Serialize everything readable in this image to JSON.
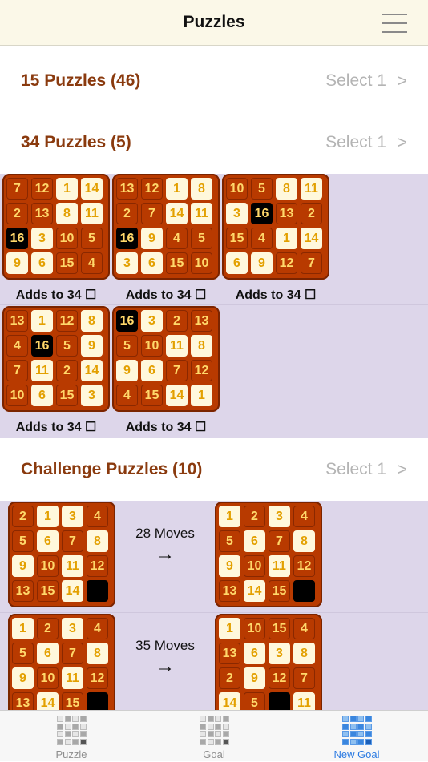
{
  "nav": {
    "title": "Puzzles",
    "menu_icon": "hamburger-menu-icon"
  },
  "sections": {
    "p15": {
      "title": "15 Puzzles (46)",
      "select": "Select 1",
      "chevron": ">"
    },
    "p34": {
      "title": "34 Puzzles (5)",
      "select": "Select 1",
      "chevron": ">"
    },
    "challenge": {
      "title": "Challenge Puzzles (10)",
      "select": "Select 1",
      "chevron": ">"
    }
  },
  "magic": [
    {
      "caption": "Adds to 34 ☐",
      "grid": [
        [
          7,
          12,
          1,
          14
        ],
        [
          2,
          13,
          8,
          11
        ],
        [
          16,
          3,
          10,
          5
        ],
        [
          9,
          6,
          15,
          4
        ]
      ]
    },
    {
      "caption": "Adds to 34 ☐",
      "grid": [
        [
          13,
          12,
          1,
          8
        ],
        [
          2,
          7,
          14,
          11
        ],
        [
          16,
          9,
          4,
          5
        ],
        [
          3,
          6,
          15,
          10
        ]
      ]
    },
    {
      "caption": "Adds to 34 ☐",
      "grid": [
        [
          10,
          5,
          8,
          11
        ],
        [
          3,
          16,
          13,
          2
        ],
        [
          15,
          4,
          1,
          14
        ],
        [
          6,
          9,
          12,
          7
        ]
      ]
    },
    {
      "caption": "Adds to 34 ☐",
      "grid": [
        [
          13,
          1,
          12,
          8
        ],
        [
          4,
          16,
          5,
          9
        ],
        [
          7,
          11,
          2,
          14
        ],
        [
          10,
          6,
          15,
          3
        ]
      ]
    },
    {
      "caption": "Adds to 34 ☐",
      "grid": [
        [
          16,
          3,
          2,
          13
        ],
        [
          5,
          10,
          11,
          8
        ],
        [
          9,
          6,
          7,
          12
        ],
        [
          4,
          15,
          14,
          1
        ]
      ]
    }
  ],
  "challenges": [
    {
      "moves": "28 Moves",
      "arrow": "→",
      "start": [
        [
          2,
          1,
          3,
          4
        ],
        [
          5,
          6,
          7,
          8
        ],
        [
          9,
          10,
          11,
          12
        ],
        [
          13,
          15,
          14,
          0
        ]
      ],
      "goal": [
        [
          1,
          2,
          3,
          4
        ],
        [
          5,
          6,
          7,
          8
        ],
        [
          9,
          10,
          11,
          12
        ],
        [
          13,
          14,
          15,
          0
        ]
      ]
    },
    {
      "moves": "35 Moves",
      "arrow": "→",
      "start": [
        [
          1,
          2,
          3,
          4
        ],
        [
          5,
          6,
          7,
          8
        ],
        [
          9,
          10,
          11,
          12
        ],
        [
          13,
          14,
          15,
          0
        ]
      ],
      "goal": [
        [
          1,
          10,
          15,
          4
        ],
        [
          13,
          6,
          3,
          8
        ],
        [
          2,
          9,
          12,
          7
        ],
        [
          14,
          5,
          0,
          11
        ]
      ]
    }
  ],
  "tabs": [
    {
      "label": "Puzzle",
      "icon": "puzzle-grid-icon",
      "active": false
    },
    {
      "label": "Goal",
      "icon": "goal-grid-icon",
      "active": false
    },
    {
      "label": "New Goal",
      "icon": "new-goal-grid-icon",
      "active": true
    }
  ],
  "colors": {
    "accent": "#8a3a0e",
    "tile_dark": "#b83a00",
    "tile_light": "#fff8dc",
    "band": "#ddd6ea",
    "tab_active": "#2a7ae2"
  }
}
